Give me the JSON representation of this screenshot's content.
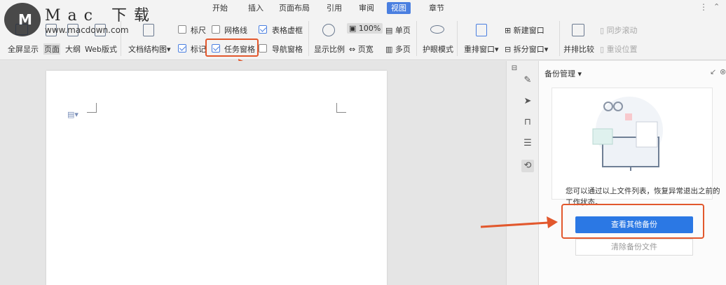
{
  "watermark": {
    "logo_letter": "M",
    "title": "Mac 下载",
    "url": "www.macdown.com"
  },
  "menu": {
    "tabs": [
      "开始",
      "插入",
      "页面布局",
      "引用",
      "审阅",
      "视图",
      "章节"
    ],
    "active": "视图",
    "more": "⋮",
    "collapse": "⌃"
  },
  "ribbon": {
    "full_screen": "全屏显示",
    "page": "页面",
    "outline": "大纲",
    "web_layout": "Web版式",
    "doc_structure": "文档结构图",
    "ruler": "标尺",
    "gridlines": "网格线",
    "table_gridlines": "表格虚框",
    "marks": "标记",
    "task_pane": "任务窗格",
    "nav_pane": "导航窗格",
    "zoom": "显示比例",
    "zoom_100": "100%",
    "one_page": "单页",
    "page_width": "页宽",
    "multi_page": "多页",
    "eye_mode": "护眼模式",
    "rearrange": "重排窗口",
    "new_window": "新建窗口",
    "split_window": "拆分窗口",
    "side_by_side": "并排比较",
    "sync_scroll": "同步滚动",
    "reset_pos": "重设位置"
  },
  "checkboxes": {
    "ruler": false,
    "gridlines": false,
    "table_gridlines": true,
    "marks": true,
    "task_pane": true,
    "nav_pane": false
  },
  "right_panel": {
    "title": "备份管理",
    "description": "您可以通过以上文件列表，恢复异常退出之前的工作状态。",
    "view_button": "查看其他备份",
    "clear_button": "清除备份文件"
  },
  "colors": {
    "accent": "#4a7fe0",
    "highlight": "#e2582d",
    "primary_button": "#2b78e4"
  }
}
